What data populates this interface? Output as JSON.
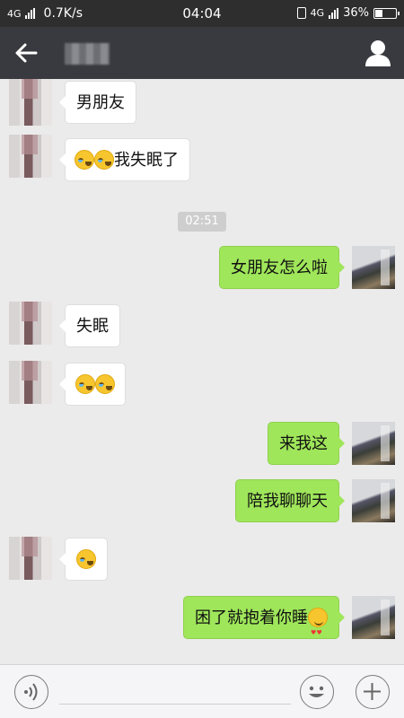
{
  "status_bar": {
    "network": "4G",
    "speed": "0.7K/s",
    "time": "04:04",
    "network_right": "4G",
    "battery": "36%",
    "battery_level": 0.36
  },
  "header": {
    "back_icon": "back-arrow-icon",
    "profile_icon": "person-icon",
    "background": "#393a3f"
  },
  "messages": [
    {
      "side": "left",
      "text": "男朋友",
      "emojis": []
    },
    {
      "side": "left",
      "text": "我失眠了",
      "emojis": [
        "crying-laughing-emoji",
        "crying-laughing-emoji"
      ]
    },
    {
      "type": "timestamp",
      "text": "02:51"
    },
    {
      "side": "right",
      "text": "女朋友怎么啦",
      "emojis": []
    },
    {
      "side": "left",
      "text": "失眠",
      "emojis": []
    },
    {
      "side": "left",
      "text": "",
      "emojis": [
        "crying-laughing-emoji",
        "crying-laughing-emoji"
      ]
    },
    {
      "side": "right",
      "text": "来我这",
      "emojis": []
    },
    {
      "side": "right",
      "text": "陪我聊聊天",
      "emojis": []
    },
    {
      "side": "left",
      "text": "",
      "emojis": [
        "crying-laughing-emoji"
      ]
    },
    {
      "side": "right",
      "text": "困了就抱着你睡",
      "emojis": [
        "heart-eyes-emoji"
      ]
    }
  ],
  "input_bar": {
    "voice_icon": "voice-icon",
    "emoji_icon": "smiley-icon",
    "plus_icon": "plus-icon",
    "text_value": ""
  },
  "colors": {
    "outgoing_bubble": "#9fe65a",
    "incoming_bubble": "#ffffff",
    "chat_background": "#ebebeb"
  }
}
